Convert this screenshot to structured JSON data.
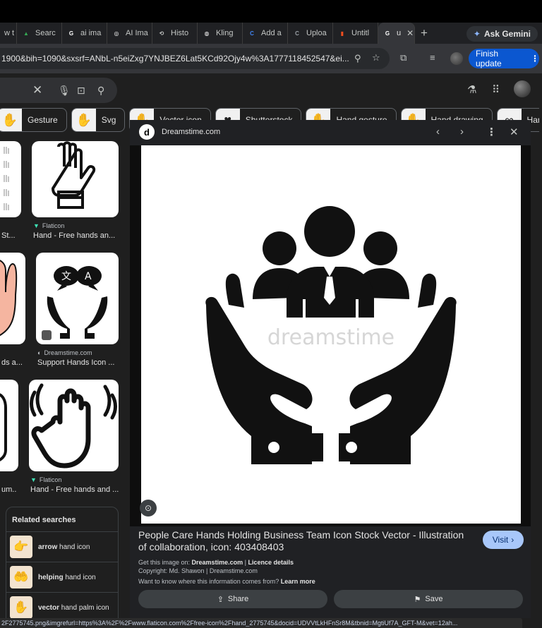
{
  "browser": {
    "tabs": [
      {
        "label": "w t",
        "fav": "",
        "fav_color": "#5f6368"
      },
      {
        "label": "Searc",
        "fav": "▲",
        "fav_color": "#34a853"
      },
      {
        "label": "ai ima",
        "fav": "G",
        "fav_color": "#ffffff"
      },
      {
        "label": "AI Ima",
        "fav": "◎",
        "fav_color": "#ffffff"
      },
      {
        "label": "Histo",
        "fav": "⟲",
        "fav_color": "#c4c7c5"
      },
      {
        "label": "Kling",
        "fav": "◍",
        "fav_color": "#ffffff"
      },
      {
        "label": "Add a",
        "fav": "C",
        "fav_color": "#4285f4"
      },
      {
        "label": "Uploa",
        "fav": "C",
        "fav_color": "#9aa0a6"
      },
      {
        "label": "Untitl",
        "fav": "▮",
        "fav_color": "#f24e1e"
      },
      {
        "label": "u",
        "fav": "G",
        "fav_color": "#ffffff",
        "active": true
      }
    ],
    "new_tab": "+",
    "ask_gemini": "Ask Gemini",
    "url": "1900&bih=1090&sxsrf=ANbL-n5eiZxg7YNJBEZ6Lat5KCd92Ojy4w%3A1777118452547&ei...",
    "finish_update": "Finish update",
    "status_url": "2F2775745.png&imgrefurl=https%3A%2F%2Fwww.flaticon.com%2Ffree-icon%2Fhand_2775745&docid=UDVVtLkHFnSr8M&tbnid=MgtiUf7A_GFT-M&vet=12ah..."
  },
  "chips": [
    {
      "label": "Gesture",
      "thumb": "✋"
    },
    {
      "label": "Svg",
      "thumb": "✋"
    },
    {
      "label": "Vector icon",
      "thumb": "✋"
    },
    {
      "label": "Shutterstock",
      "thumb": "♥"
    },
    {
      "label": "Hand gesture",
      "thumb": "✋"
    },
    {
      "label": "Hand drawing",
      "thumb": "✋"
    },
    {
      "label": "Hand symb",
      "thumb": "∞"
    }
  ],
  "results": {
    "r1": {
      "source": "",
      "title": "St..."
    },
    "r2": {
      "source": "Flaticon",
      "title": "Hand - Free hands an..."
    },
    "r3": {
      "source": "",
      "title": "ds a..."
    },
    "r4": {
      "source": "Dreamstime.com",
      "title": "Support Hands Icon ..."
    },
    "r5": {
      "source": "",
      "title": "um..."
    },
    "r6": {
      "source": "Flaticon",
      "title": "Hand - Free hands and ..."
    }
  },
  "related": {
    "heading": "Related searches",
    "items": [
      {
        "bold": "arrow",
        "rest": " hand icon",
        "thumb": "👉"
      },
      {
        "bold": "helping",
        "rest": " hand icon",
        "thumb": "🤲"
      },
      {
        "bold": "vector",
        "rest": " hand palm icon",
        "thumb": "✋"
      }
    ]
  },
  "preview": {
    "site": "Dreamstime.com",
    "site_logo": "d",
    "watermark": "dreamstime",
    "title": "People Care Hands Holding Business Team Icon Stock Vector - Illustration of collaboration, icon: 403408403",
    "visit": "Visit",
    "get_image_prefix": "Get this image on: ",
    "get_image_site": "Dreamstime.com",
    "get_image_sep": " | ",
    "licence": "Licence details",
    "copyright": "Copyright: Md. Shawon | Dreamstime.com",
    "where_from": "Want to know where this information comes from? ",
    "learn_more": "Learn more",
    "share": "Share",
    "save": "Save"
  }
}
